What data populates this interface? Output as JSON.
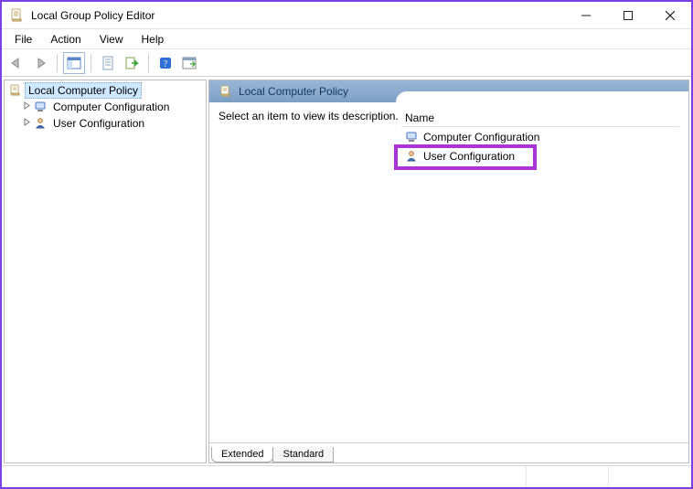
{
  "window": {
    "title": "Local Group Policy Editor"
  },
  "menu": {
    "file": "File",
    "action": "Action",
    "view": "View",
    "help": "Help"
  },
  "tree": {
    "root": "Local Computer Policy",
    "child1": "Computer Configuration",
    "child2": "User Configuration"
  },
  "detail": {
    "header": "Local Computer Policy",
    "hint": "Select an item to view its description.",
    "column": "Name",
    "row1": "Computer Configuration",
    "row2": "User Configuration"
  },
  "tabs": {
    "extended": "Extended",
    "standard": "Standard"
  }
}
